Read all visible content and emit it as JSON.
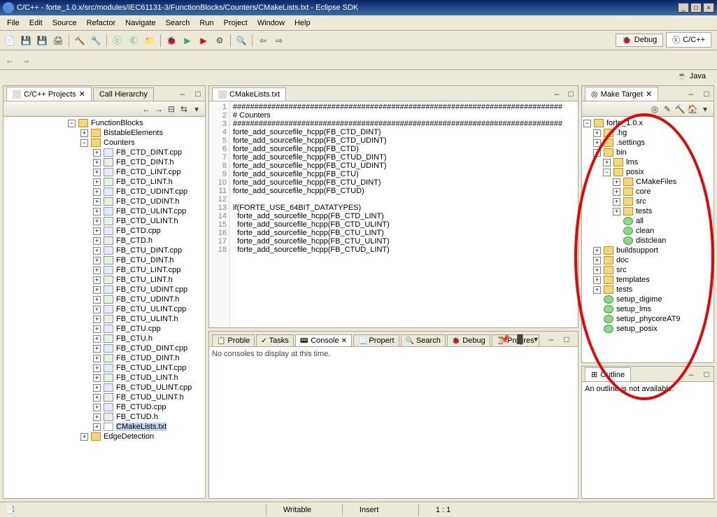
{
  "window": {
    "title": "C/C++ - forte_1.0.x/src/modules/IEC61131-3/FunctionBlocks/Counters/CMakeLists.txt - Eclipse SDK"
  },
  "menus": [
    "File",
    "Edit",
    "Source",
    "Refactor",
    "Navigate",
    "Search",
    "Run",
    "Project",
    "Window",
    "Help"
  ],
  "perspectives": {
    "debug": "Debug",
    "cpp": "C/C++",
    "java": "Java"
  },
  "left_tabs": {
    "projects": "C/C++ Projects",
    "call": "Call Hierarchy"
  },
  "project_tree": {
    "root": "FunctionBlocks",
    "folders": [
      {
        "name": "BistableElements",
        "expanded": false
      },
      {
        "name": "Counters",
        "expanded": true,
        "files": [
          "FB_CTD_DINT.cpp",
          "FB_CTD_DINT.h",
          "FB_CTD_LINT.cpp",
          "FB_CTD_LINT.h",
          "FB_CTD_UDINT.cpp",
          "FB_CTD_UDINT.h",
          "FB_CTD_ULINT.cpp",
          "FB_CTD_ULINT.h",
          "FB_CTD.cpp",
          "FB_CTD.h",
          "FB_CTU_DINT.cpp",
          "FB_CTU_DINT.h",
          "FB_CTU_LINT.cpp",
          "FB_CTU_LINT.h",
          "FB_CTU_UDINT.cpp",
          "FB_CTU_UDINT.h",
          "FB_CTU_ULINT.cpp",
          "FB_CTU_ULINT.h",
          "FB_CTU.cpp",
          "FB_CTU.h",
          "FB_CTUD_DINT.cpp",
          "FB_CTUD_DINT.h",
          "FB_CTUD_LINT.cpp",
          "FB_CTUD_LINT.h",
          "FB_CTUD_ULINT.cpp",
          "FB_CTUD_ULINT.h",
          "FB_CTUD.cpp",
          "FB_CTUD.h",
          "CMakeLists.txt"
        ]
      },
      {
        "name": "EdgeDetection",
        "expanded": false
      }
    ]
  },
  "editor": {
    "tab": "CMakeLists.txt",
    "lines": [
      "#############################################################################",
      "# Counters",
      "#############################################################################",
      "forte_add_sourcefile_hcpp(FB_CTD_DINT)",
      "forte_add_sourcefile_hcpp(FB_CTD_UDINT)",
      "forte_add_sourcefile_hcpp(FB_CTD)",
      "forte_add_sourcefile_hcpp(FB_CTUD_DINT)",
      "forte_add_sourcefile_hcpp(FB_CTU_UDINT)",
      "forte_add_sourcefile_hcpp(FB_CTU)",
      "forte_add_sourcefile_hcpp(FB_CTU_DINT)",
      "forte_add_sourcefile_hcpp(FB_CTUD)",
      "",
      "if(FORTE_USE_64BIT_DATATYPES)",
      "  forte_add_sourcefile_hcpp(FB_CTD_LINT)",
      "  forte_add_sourcefile_hcpp(FB_CTD_ULINT)",
      "  forte_add_sourcefile_hcpp(FB_CTU_LINT)",
      "  forte_add_sourcefile_hcpp(FB_CTU_ULINT)",
      "  forte_add_sourcefile_hcpp(FB_CTUD_LINT)"
    ]
  },
  "console_tabs": [
    "Proble",
    "Tasks",
    "Console",
    "Propert",
    "Search",
    "Debug",
    "Progres"
  ],
  "console_msg": "No consoles to display at this time.",
  "make_target": {
    "tab": "Make Target",
    "root": "forte_1.0.x",
    "nodes": [
      {
        "name": ".hg",
        "type": "folder"
      },
      {
        "name": ".settings",
        "type": "folder"
      },
      {
        "name": "bin",
        "type": "folder",
        "expanded": true,
        "children": [
          {
            "name": "lms",
            "type": "folder"
          },
          {
            "name": "posix",
            "type": "folder",
            "expanded": true,
            "children": [
              {
                "name": "CMakeFiles",
                "type": "folder"
              },
              {
                "name": "core",
                "type": "folder"
              },
              {
                "name": "src",
                "type": "folder"
              },
              {
                "name": "tests",
                "type": "folder"
              },
              {
                "name": "all",
                "type": "target"
              },
              {
                "name": "clean",
                "type": "target"
              },
              {
                "name": "distclean",
                "type": "target"
              }
            ]
          }
        ]
      },
      {
        "name": "buildsupport",
        "type": "folder"
      },
      {
        "name": "doc",
        "type": "folder"
      },
      {
        "name": "src",
        "type": "folder"
      },
      {
        "name": "templates",
        "type": "folder"
      },
      {
        "name": "tests",
        "type": "folder"
      },
      {
        "name": "setup_digime",
        "type": "target"
      },
      {
        "name": "setup_lms",
        "type": "target"
      },
      {
        "name": "setup_phycoreAT9",
        "type": "target"
      },
      {
        "name": "setup_posix",
        "type": "target"
      }
    ]
  },
  "outline": {
    "tab": "Outline",
    "msg": "An outline is not available."
  },
  "status": {
    "writable": "Writable",
    "insert": "Insert",
    "pos": "1 : 1"
  }
}
